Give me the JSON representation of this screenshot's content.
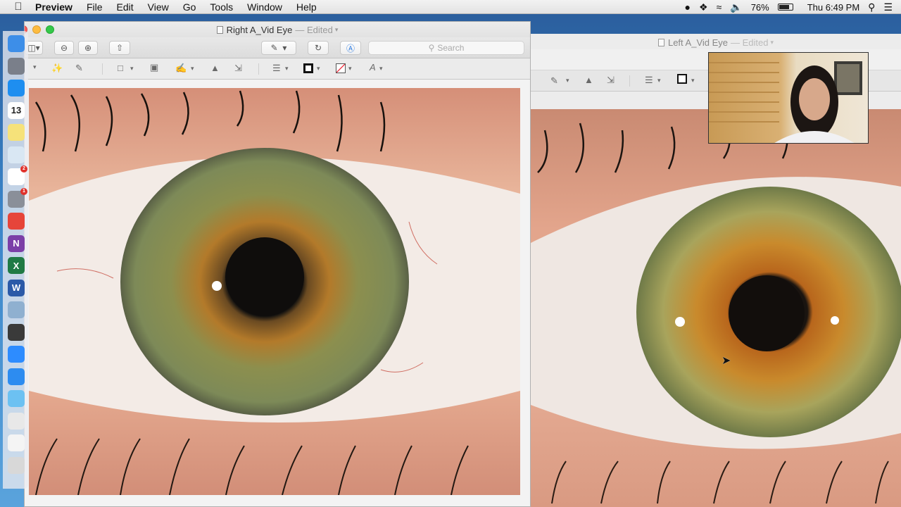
{
  "menubar": {
    "apple": "",
    "app_name": "Preview",
    "items": [
      "File",
      "Edit",
      "View",
      "Go",
      "Tools",
      "Window",
      "Help"
    ],
    "battery": "76%",
    "clock": "Thu 6:49 PM",
    "status_icons": [
      "siri-icon",
      "dropbox-icon",
      "wifi-icon",
      "volume-icon",
      "battery-icon",
      "spotlight-icon",
      "notification-center-icon"
    ]
  },
  "dock": {
    "items": [
      {
        "name": "finder",
        "color": "#3d8ee8"
      },
      {
        "name": "launchpad",
        "color": "#7a7f8a"
      },
      {
        "name": "safari",
        "color": "#1e8ef0"
      },
      {
        "name": "calendar",
        "color": "#ffffff",
        "text": "13"
      },
      {
        "name": "notes",
        "color": "#f6e27a"
      },
      {
        "name": "preview",
        "color": "#d9e7f3"
      },
      {
        "name": "reminders",
        "color": "#ffffff",
        "badge": "2"
      },
      {
        "name": "system-preferences",
        "color": "#8a8f99",
        "badge": "1"
      },
      {
        "name": "chrome",
        "color": "#e6453a"
      },
      {
        "name": "onenote",
        "color": "#7b3fa8",
        "text": "N"
      },
      {
        "name": "excel",
        "color": "#1f7a45",
        "text": "X"
      },
      {
        "name": "word",
        "color": "#2b5aa8",
        "text": "W"
      },
      {
        "name": "image-capture",
        "color": "#8fb0d0"
      },
      {
        "name": "quicktime",
        "color": "#3a3a3a"
      },
      {
        "name": "zoom",
        "color": "#2d8cff"
      },
      {
        "name": "app-store",
        "color": "#2d8cf0"
      },
      {
        "name": "downloads-folder",
        "color": "#6cc1f2"
      },
      {
        "name": "recent-files",
        "color": "#e8e8e8"
      },
      {
        "name": "documents-stack",
        "color": "#f4f4f4"
      },
      {
        "name": "trash",
        "color": "#d8d8d8"
      }
    ]
  },
  "right_window": {
    "title": "Right A_Vid Eye",
    "edited": "— Edited",
    "search_placeholder": "Search"
  },
  "left_window": {
    "title": "Left A_Vid Eye",
    "edited": "— Edited"
  },
  "colors": {
    "close": "#fc605c",
    "minimize": "#fdbc40",
    "zoom": "#34c84a",
    "iris_green": "#8a9a55",
    "iris_amber": "#c98a2c",
    "skin": "#e8b49a"
  }
}
